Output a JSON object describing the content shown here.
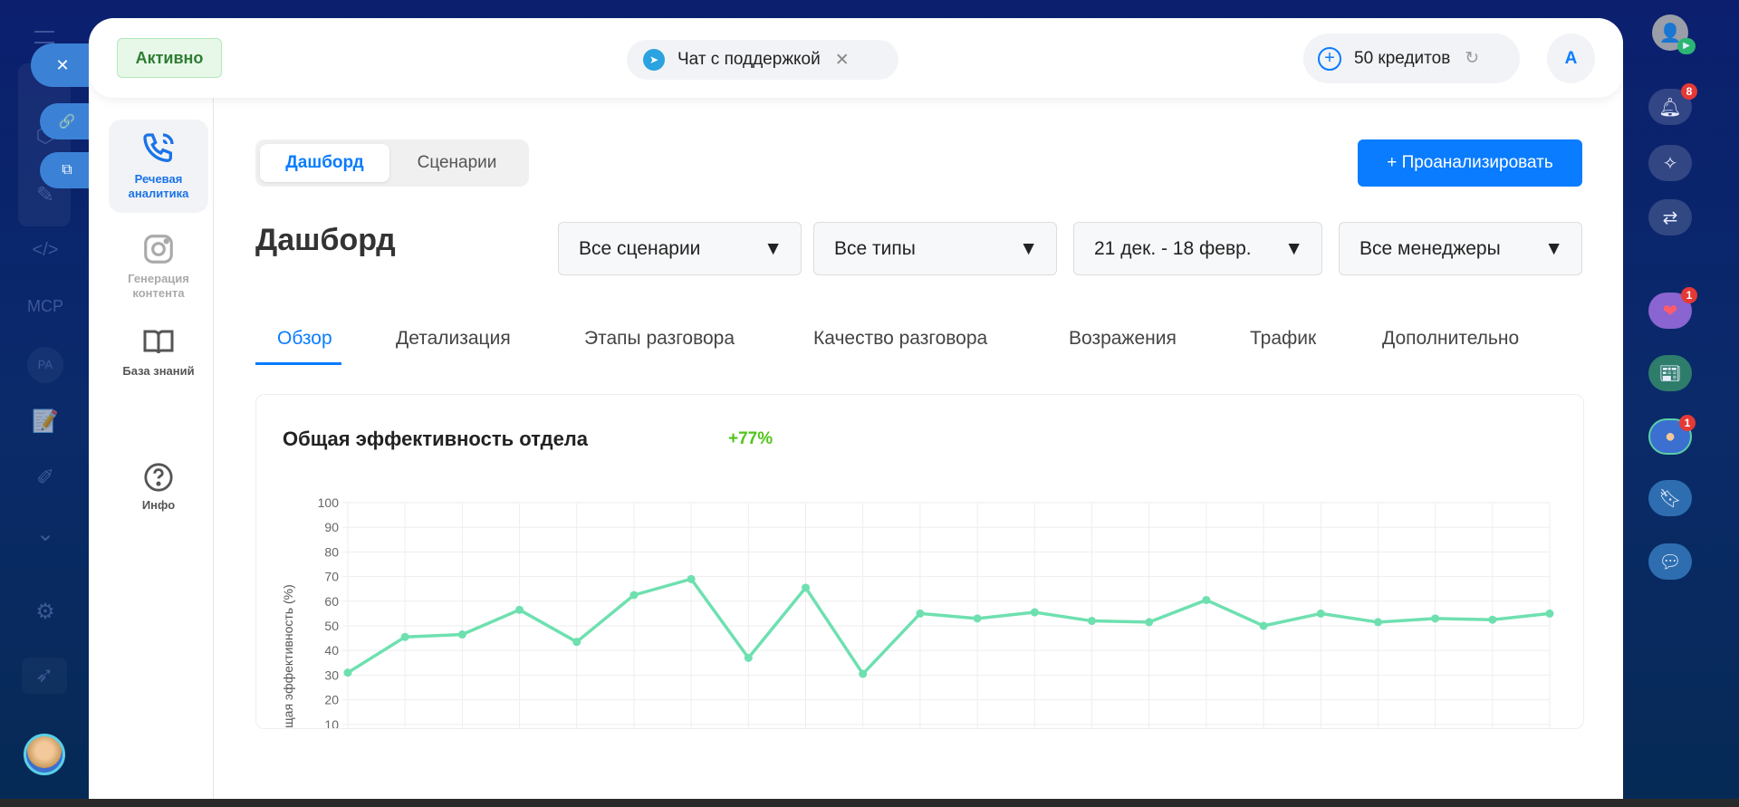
{
  "left_sidebar": {
    "icons": [
      "cube-icon",
      "pencils-icon",
      "code-icon",
      "mcp-icon",
      "pa-icon",
      "doc-edit-icon",
      "pen-icon",
      "chevron-down-icon",
      "gear-icon",
      "rocket-icon"
    ],
    "mcp_label": "MCP",
    "pa_label": "PA"
  },
  "header": {
    "status": "Активно",
    "support_chat": "Чат с поддержкой",
    "credits": "50 кредитов",
    "avatar_letter": "A"
  },
  "nav": [
    {
      "label": "Речевая аналитика",
      "icon": "phone-waves-icon",
      "active": true
    },
    {
      "label": "Генерация контента",
      "icon": "instagram-icon",
      "active": false
    },
    {
      "label": "База знаний",
      "icon": "book-icon",
      "active": false
    },
    {
      "label": "Инфо",
      "icon": "help-icon",
      "active": false
    }
  ],
  "view_tabs": [
    "Дашборд",
    "Сценарии"
  ],
  "analyze_button": "+ Проанализировать",
  "page_title": "Дашборд",
  "filters": [
    "Все сценарии",
    "Все типы",
    "21 дек. - 18 февр.",
    "Все менеджеры"
  ],
  "tabs": [
    "Обзор",
    "Детализация",
    "Этапы разговора",
    "Качество разговора",
    "Возражения",
    "Трафик",
    "Дополнительно"
  ],
  "right_sidebar": {
    "notifications": "8",
    "badge_1": "1",
    "badge_2": "1"
  },
  "colors": {
    "accent": "#0a7cff",
    "line": "#6ee0b0",
    "delta": "#52c41a"
  },
  "chart_data": {
    "type": "line",
    "title": "Общая эффективность отдела",
    "delta": "+77%",
    "ylabel": "Общая эффективность (%)",
    "xlabel": "",
    "ylim": [
      10,
      100
    ],
    "yticks": [
      "100",
      "90",
      "80",
      "70",
      "60",
      "50",
      "40",
      "30",
      "20",
      "10"
    ],
    "values": [
      31,
      45.5,
      46.5,
      56.5,
      43.5,
      62.5,
      69,
      37,
      65.5,
      30.5,
      55,
      53,
      55.5,
      52,
      51.5,
      60.5,
      50,
      55,
      51.5,
      53,
      52.5,
      55
    ],
    "grid": true
  }
}
